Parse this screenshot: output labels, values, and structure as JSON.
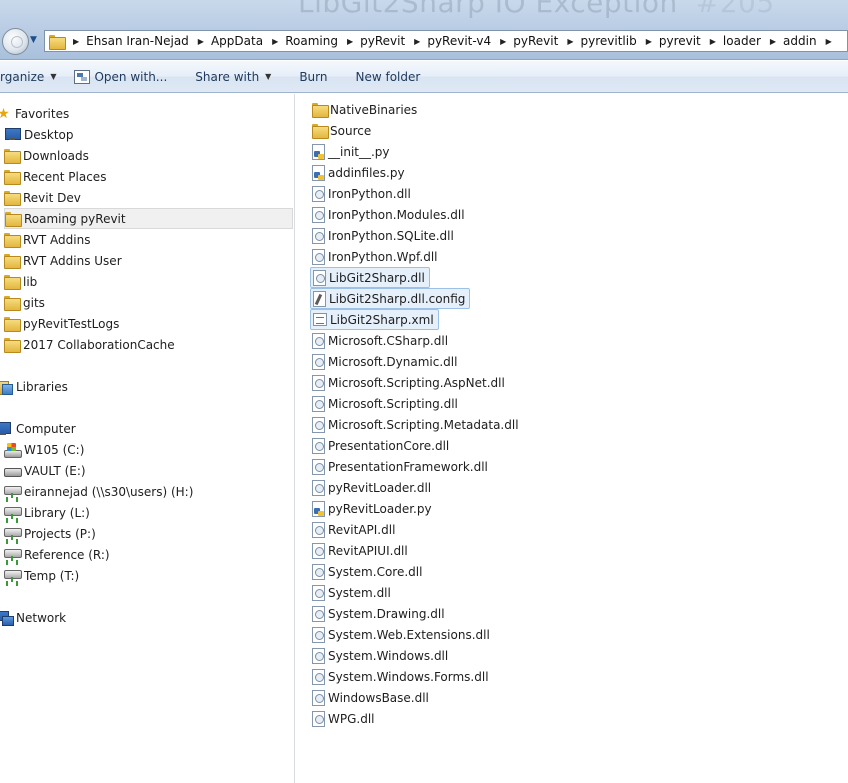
{
  "window": {
    "background_title": "LibGit2Sharp IO Exception",
    "background_issue": "#205"
  },
  "address_bar": {
    "crumbs": [
      "Ehsan Iran-Nejad",
      "AppData",
      "Roaming",
      "pyRevit",
      "pyRevit-v4",
      "pyRevit",
      "pyrevitlib",
      "pyrevit",
      "loader",
      "addin"
    ]
  },
  "command_bar": {
    "organize": "rganize",
    "open_with": "Open with...",
    "share_with": "Share with",
    "burn": "Burn",
    "new_folder": "New folder"
  },
  "nav": {
    "favorites_header": "Favorites",
    "favorites": [
      "Desktop",
      "Downloads",
      "Recent Places",
      "Revit Dev",
      "Roaming pyRevit",
      "RVT Addins",
      "RVT Addins User",
      "lib",
      "gits",
      "pyRevitTestLogs",
      "2017 CollaborationCache"
    ],
    "selected_favorite": "Roaming pyRevit",
    "libraries_header": "Libraries",
    "computer_header": "Computer",
    "drives": [
      "W105 (C:)",
      "VAULT (E:)",
      "eirannejad (\\\\s30\\users) (H:)",
      "Library (L:)",
      "Projects (P:)",
      "Reference (R:)",
      "Temp (T:)"
    ],
    "network_header": "Network"
  },
  "files": [
    {
      "name": "NativeBinaries",
      "icon": "folder-icon"
    },
    {
      "name": "Source",
      "icon": "folder-icon"
    },
    {
      "name": "__init__.py",
      "icon": "python-file-icon"
    },
    {
      "name": "addinfiles.py",
      "icon": "python-file-icon"
    },
    {
      "name": "IronPython.dll",
      "icon": "dll-file-icon"
    },
    {
      "name": "IronPython.Modules.dll",
      "icon": "dll-file-icon"
    },
    {
      "name": "IronPython.SQLite.dll",
      "icon": "dll-file-icon"
    },
    {
      "name": "IronPython.Wpf.dll",
      "icon": "dll-file-icon"
    },
    {
      "name": "LibGit2Sharp.dll",
      "icon": "dll-file-icon",
      "selected": true
    },
    {
      "name": "LibGit2Sharp.dll.config",
      "icon": "config-file-icon",
      "selected": true
    },
    {
      "name": "LibGit2Sharp.xml",
      "icon": "xml-file-icon",
      "selected": true
    },
    {
      "name": "Microsoft.CSharp.dll",
      "icon": "dll-file-icon"
    },
    {
      "name": "Microsoft.Dynamic.dll",
      "icon": "dll-file-icon"
    },
    {
      "name": "Microsoft.Scripting.AspNet.dll",
      "icon": "dll-file-icon"
    },
    {
      "name": "Microsoft.Scripting.dll",
      "icon": "dll-file-icon"
    },
    {
      "name": "Microsoft.Scripting.Metadata.dll",
      "icon": "dll-file-icon"
    },
    {
      "name": "PresentationCore.dll",
      "icon": "dll-file-icon"
    },
    {
      "name": "PresentationFramework.dll",
      "icon": "dll-file-icon"
    },
    {
      "name": "pyRevitLoader.dll",
      "icon": "dll-file-icon"
    },
    {
      "name": "pyRevitLoader.py",
      "icon": "python-file-icon"
    },
    {
      "name": "RevitAPI.dll",
      "icon": "dll-file-icon"
    },
    {
      "name": "RevitAPIUI.dll",
      "icon": "dll-file-icon"
    },
    {
      "name": "System.Core.dll",
      "icon": "dll-file-icon"
    },
    {
      "name": "System.dll",
      "icon": "dll-file-icon"
    },
    {
      "name": "System.Drawing.dll",
      "icon": "dll-file-icon"
    },
    {
      "name": "System.Web.Extensions.dll",
      "icon": "dll-file-icon"
    },
    {
      "name": "System.Windows.dll",
      "icon": "dll-file-icon"
    },
    {
      "name": "System.Windows.Forms.dll",
      "icon": "dll-file-icon"
    },
    {
      "name": "WindowsBase.dll",
      "icon": "dll-file-icon"
    },
    {
      "name": "WPG.dll",
      "icon": "dll-file-icon"
    }
  ],
  "colors": {
    "selection_fill": "#e5f0fb",
    "selection_border": "#9dc1e6",
    "command_text": "#1e395b"
  }
}
